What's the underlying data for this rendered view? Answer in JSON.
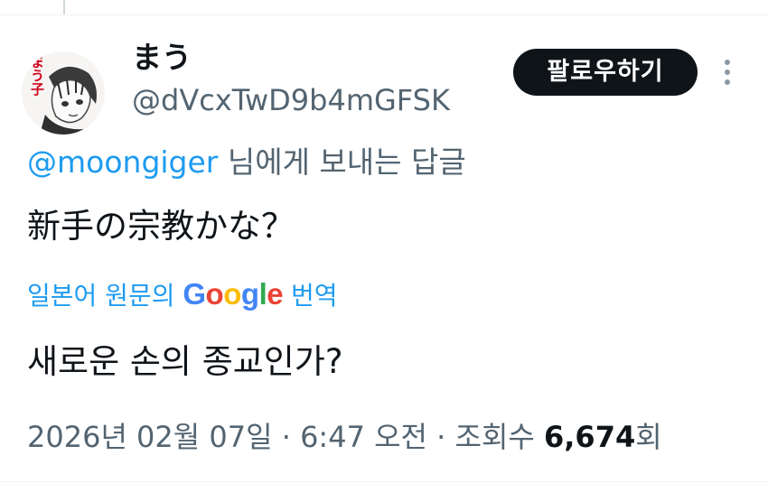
{
  "author": {
    "display_name": "まう",
    "handle": "@dVcxTwD9b4mGFSK",
    "avatar_text": "まう子"
  },
  "actions": {
    "follow_label": "팔로우하기",
    "more_icon": "more-vertical-icon"
  },
  "reply": {
    "mention": "@moongiger",
    "suffix": " 님에게 보내는 답글"
  },
  "tweet": {
    "text": "新手の宗教かな？"
  },
  "translation": {
    "prefix": "일본어 원문의 ",
    "google_letters": [
      "G",
      "o",
      "o",
      "g",
      "l",
      "e"
    ],
    "google_colors": [
      "#4285F4",
      "#EA4335",
      "#FBBC05",
      "#4285F4",
      "#34A853",
      "#EA4335"
    ],
    "suffix": " 번역",
    "text": "새로운 손의 종교인가?"
  },
  "meta": {
    "date": "2026년 02월 07일",
    "sep1": " · ",
    "time": "6:47 오전",
    "sep2": " · ",
    "views_label": "조회수 ",
    "views_count": "6,674",
    "views_suffix": "회"
  },
  "colors": {
    "link": "#1d9bf0",
    "secondary_text": "#536471",
    "primary_text": "#0f1419",
    "button_bg": "#0f1419"
  }
}
